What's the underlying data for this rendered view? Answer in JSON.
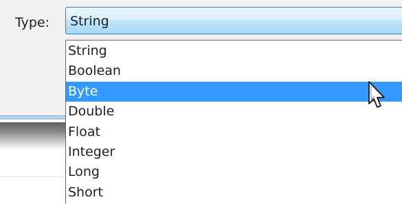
{
  "field": {
    "label": "Type:",
    "selected_value": "String"
  },
  "dropdown": {
    "options": [
      "String",
      "Boolean",
      "Byte",
      "Double",
      "Float",
      "Integer",
      "Long",
      "Short"
    ],
    "highlighted_option": "Byte"
  },
  "icons": {
    "cursor": "mouse-pointer-icon"
  },
  "colors": {
    "highlight": "#3399ff",
    "combobox_border": "#3c7fb1"
  }
}
